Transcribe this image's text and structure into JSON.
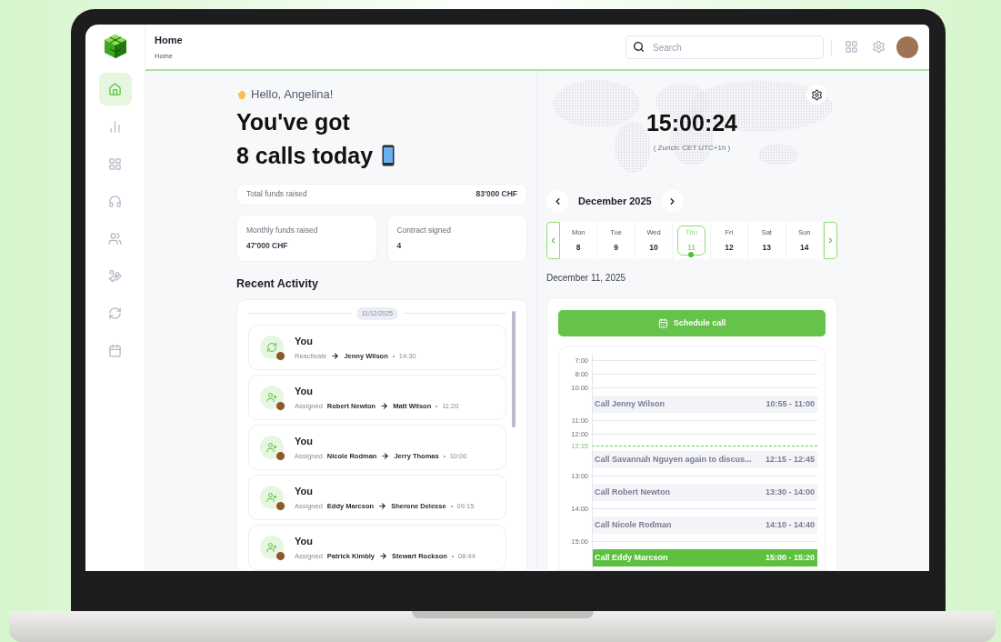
{
  "sidebar": {
    "items": [
      {
        "selected": true
      },
      {
        "selected": false
      },
      {
        "selected": false
      },
      {
        "selected": false
      },
      {
        "selected": false
      },
      {
        "selected": false
      },
      {
        "selected": false
      },
      {
        "selected": false
      }
    ]
  },
  "header": {
    "title": "Home",
    "breadcrumb": "Home",
    "search": {
      "placeholder": "Search"
    }
  },
  "greeting": {
    "hello": "Hello, Angelina!",
    "headline_1": "You've got",
    "headline_2": "8 calls today"
  },
  "stats": [
    {
      "label": "Total funds raised",
      "value": "83'000 CHF"
    },
    {
      "label": "Monthly funds raised",
      "value": "47'000 CHF"
    },
    {
      "label": "Contract signed",
      "value": "4"
    }
  ],
  "recent_activity": {
    "title": "Recent Activity",
    "date": "11/12/2025",
    "items": [
      {
        "kind": "reactivate",
        "actor": "You",
        "action": "Reactivate",
        "to": "Jenny Wilson",
        "time": "14:30"
      },
      {
        "kind": "assign",
        "actor": "You",
        "action": "Assigned",
        "from": "Robert Newton",
        "to": "Matt Wilson",
        "time": "11:20"
      },
      {
        "kind": "assign",
        "actor": "You",
        "action": "Assigned",
        "from": "Nicole Rodman",
        "to": "Jerry Thomas",
        "time": "10:00"
      },
      {
        "kind": "assign",
        "actor": "You",
        "action": "Assigned",
        "from": "Eddy Marcson",
        "to": "Sherone Delesse",
        "time": "09:15"
      },
      {
        "kind": "assign",
        "actor": "You",
        "action": "Assigned",
        "from": "Patrick Kimbly",
        "to": "Stewart Rockson",
        "time": "08:44"
      }
    ]
  },
  "clock": {
    "time": "15:00:24",
    "zone": "( Zurich: CET UTC+1h )"
  },
  "calendar": {
    "month": "December 2025",
    "days": [
      {
        "weekday": "Mon",
        "day": "8",
        "selected": false
      },
      {
        "weekday": "Tue",
        "day": "9",
        "selected": false
      },
      {
        "weekday": "Wed",
        "day": "10",
        "selected": false
      },
      {
        "weekday": "Thu",
        "day": "11",
        "selected": true
      },
      {
        "weekday": "Fri",
        "day": "12",
        "selected": false
      },
      {
        "weekday": "Sat",
        "day": "13",
        "selected": false
      },
      {
        "weekday": "Sun",
        "day": "14",
        "selected": false
      }
    ],
    "date_label": "December 11, 2025"
  },
  "schedule": {
    "button": "Schedule call",
    "timeline": [
      {
        "kind": "hour",
        "label": "7:00"
      },
      {
        "kind": "hour",
        "label": "8:00"
      },
      {
        "kind": "hour",
        "label": "10:00"
      },
      {
        "kind": "event",
        "title": "Call Jenny Wilson",
        "time": "10:55 - 11:00",
        "current": false
      },
      {
        "kind": "hour",
        "label": "11:00"
      },
      {
        "kind": "hour",
        "label": "12:00"
      },
      {
        "kind": "now",
        "label": "12:15"
      },
      {
        "kind": "event",
        "title": "Call Savannah Nguyen again to discus...",
        "time": "12:15 - 12:45",
        "current": false
      },
      {
        "kind": "hour",
        "label": "13:00"
      },
      {
        "kind": "event",
        "title": "Call Robert Newton",
        "time": "13:30 - 14:00",
        "current": false
      },
      {
        "kind": "hour",
        "label": "14:00"
      },
      {
        "kind": "event",
        "title": "Call Nicole Rodman",
        "time": "14:10 - 14:40",
        "current": false
      },
      {
        "kind": "hour",
        "label": "15:00"
      },
      {
        "kind": "event",
        "title": "Call Eddy Marcson",
        "time": "15:00 - 15:20",
        "current": true
      }
    ]
  }
}
